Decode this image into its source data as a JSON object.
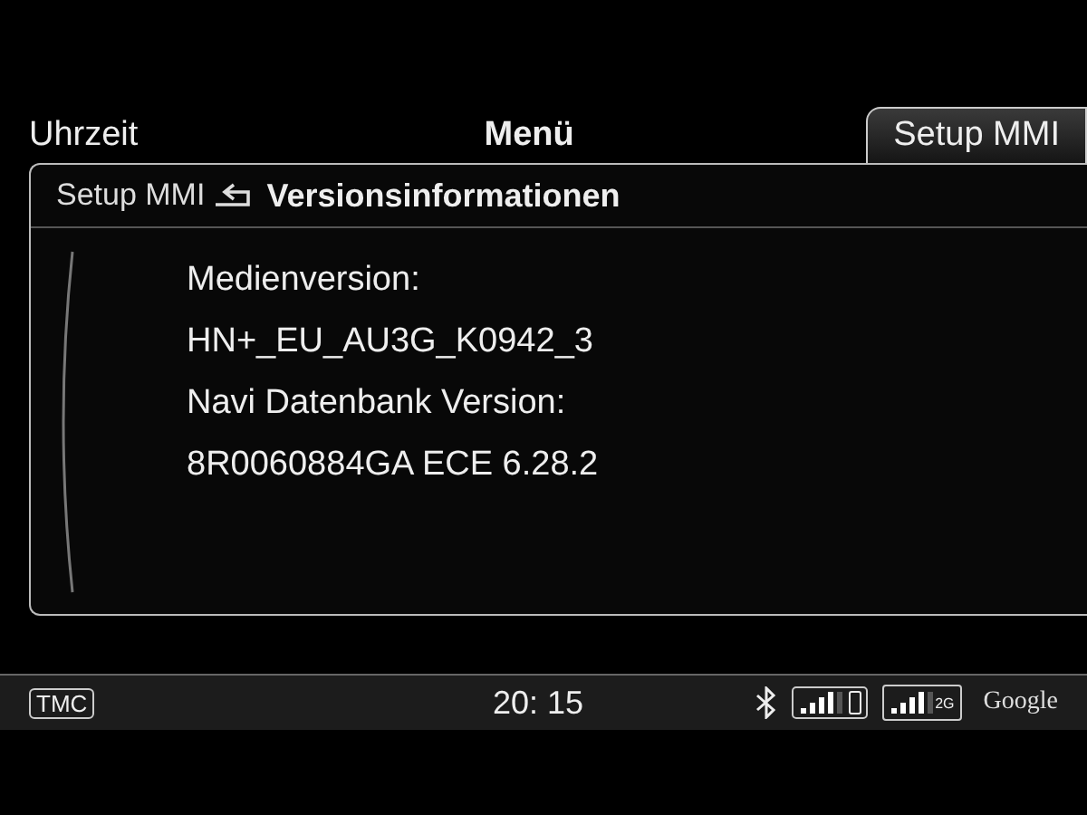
{
  "tabs": [
    {
      "label": "Uhrzeit",
      "selected": false,
      "kind": "left"
    },
    {
      "label": "Menü",
      "selected": false,
      "kind": "center"
    },
    {
      "label": "Setup MMI",
      "selected": true,
      "kind": "right"
    }
  ],
  "breadcrumb": {
    "parent": "Setup MMI",
    "title": "Versionsinformationen"
  },
  "lines": [
    "Medienversion:",
    "HN+_EU_AU3G_K0942_3",
    "Navi Datenbank Version:",
    "8R0060884GA ECE 6.28.2"
  ],
  "status_bar": {
    "tmc": "TMC",
    "time": "20: 15",
    "network": "2G",
    "brand": "Google"
  }
}
